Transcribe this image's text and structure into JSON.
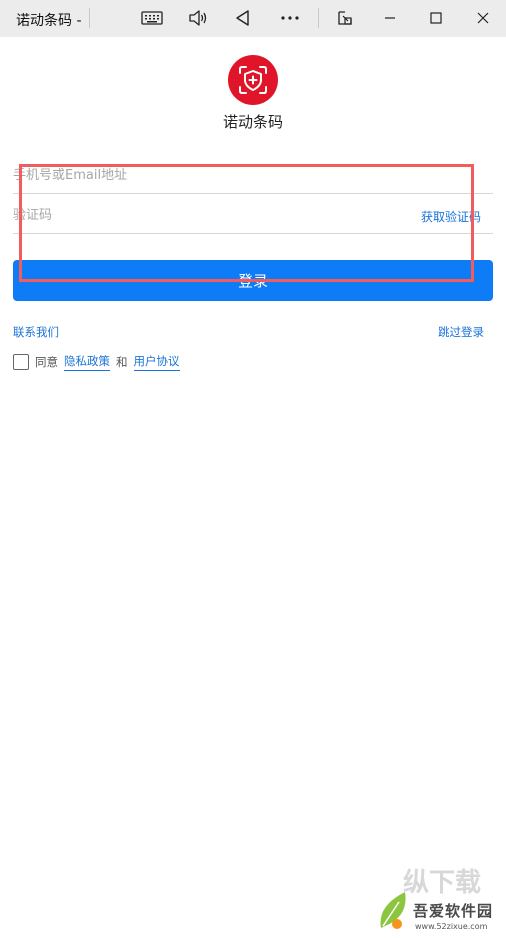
{
  "window": {
    "title": "诺动条码 -",
    "icons": {
      "keyboard": "keyboard-icon",
      "speaker": "speaker-icon",
      "back": "back-triangle-icon",
      "more": "more-dots-icon",
      "pip": "picture-in-picture-icon",
      "minimize": "minimize-icon",
      "maximize": "maximize-icon",
      "close": "close-icon"
    }
  },
  "app": {
    "name": "诺动条码",
    "logo_icon": "shield-scan-icon",
    "brand_color": "#e0152a"
  },
  "form": {
    "phone_placeholder": "手机号或Email地址",
    "code_placeholder": "验证码",
    "get_code_label": "获取验证码",
    "login_label": "登录",
    "login_color": "#0f7cf7"
  },
  "links": {
    "contact": "联系我们",
    "skip_login": "跳过登录"
  },
  "agreement": {
    "prefix": "同意",
    "privacy": "隐私政策",
    "conjunction": "和",
    "terms": "用户协议"
  },
  "watermark": {
    "big": "纵下载",
    "main": "吾爱软件园",
    "url": "www.52zixue.com"
  }
}
